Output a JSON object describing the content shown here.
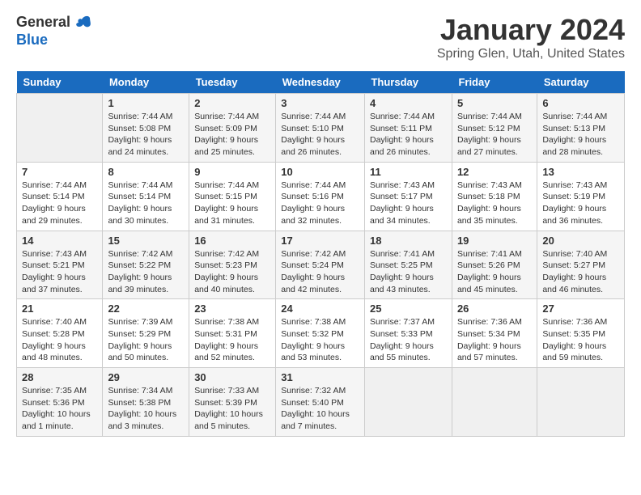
{
  "logo": {
    "general": "General",
    "blue": "Blue"
  },
  "title": "January 2024",
  "location": "Spring Glen, Utah, United States",
  "days_of_week": [
    "Sunday",
    "Monday",
    "Tuesday",
    "Wednesday",
    "Thursday",
    "Friday",
    "Saturday"
  ],
  "weeks": [
    [
      {
        "day": "",
        "info": ""
      },
      {
        "day": "1",
        "info": "Sunrise: 7:44 AM\nSunset: 5:08 PM\nDaylight: 9 hours\nand 24 minutes."
      },
      {
        "day": "2",
        "info": "Sunrise: 7:44 AM\nSunset: 5:09 PM\nDaylight: 9 hours\nand 25 minutes."
      },
      {
        "day": "3",
        "info": "Sunrise: 7:44 AM\nSunset: 5:10 PM\nDaylight: 9 hours\nand 26 minutes."
      },
      {
        "day": "4",
        "info": "Sunrise: 7:44 AM\nSunset: 5:11 PM\nDaylight: 9 hours\nand 26 minutes."
      },
      {
        "day": "5",
        "info": "Sunrise: 7:44 AM\nSunset: 5:12 PM\nDaylight: 9 hours\nand 27 minutes."
      },
      {
        "day": "6",
        "info": "Sunrise: 7:44 AM\nSunset: 5:13 PM\nDaylight: 9 hours\nand 28 minutes."
      }
    ],
    [
      {
        "day": "7",
        "info": "Sunrise: 7:44 AM\nSunset: 5:14 PM\nDaylight: 9 hours\nand 29 minutes."
      },
      {
        "day": "8",
        "info": "Sunrise: 7:44 AM\nSunset: 5:14 PM\nDaylight: 9 hours\nand 30 minutes."
      },
      {
        "day": "9",
        "info": "Sunrise: 7:44 AM\nSunset: 5:15 PM\nDaylight: 9 hours\nand 31 minutes."
      },
      {
        "day": "10",
        "info": "Sunrise: 7:44 AM\nSunset: 5:16 PM\nDaylight: 9 hours\nand 32 minutes."
      },
      {
        "day": "11",
        "info": "Sunrise: 7:43 AM\nSunset: 5:17 PM\nDaylight: 9 hours\nand 34 minutes."
      },
      {
        "day": "12",
        "info": "Sunrise: 7:43 AM\nSunset: 5:18 PM\nDaylight: 9 hours\nand 35 minutes."
      },
      {
        "day": "13",
        "info": "Sunrise: 7:43 AM\nSunset: 5:19 PM\nDaylight: 9 hours\nand 36 minutes."
      }
    ],
    [
      {
        "day": "14",
        "info": "Sunrise: 7:43 AM\nSunset: 5:21 PM\nDaylight: 9 hours\nand 37 minutes."
      },
      {
        "day": "15",
        "info": "Sunrise: 7:42 AM\nSunset: 5:22 PM\nDaylight: 9 hours\nand 39 minutes."
      },
      {
        "day": "16",
        "info": "Sunrise: 7:42 AM\nSunset: 5:23 PM\nDaylight: 9 hours\nand 40 minutes."
      },
      {
        "day": "17",
        "info": "Sunrise: 7:42 AM\nSunset: 5:24 PM\nDaylight: 9 hours\nand 42 minutes."
      },
      {
        "day": "18",
        "info": "Sunrise: 7:41 AM\nSunset: 5:25 PM\nDaylight: 9 hours\nand 43 minutes."
      },
      {
        "day": "19",
        "info": "Sunrise: 7:41 AM\nSunset: 5:26 PM\nDaylight: 9 hours\nand 45 minutes."
      },
      {
        "day": "20",
        "info": "Sunrise: 7:40 AM\nSunset: 5:27 PM\nDaylight: 9 hours\nand 46 minutes."
      }
    ],
    [
      {
        "day": "21",
        "info": "Sunrise: 7:40 AM\nSunset: 5:28 PM\nDaylight: 9 hours\nand 48 minutes."
      },
      {
        "day": "22",
        "info": "Sunrise: 7:39 AM\nSunset: 5:29 PM\nDaylight: 9 hours\nand 50 minutes."
      },
      {
        "day": "23",
        "info": "Sunrise: 7:38 AM\nSunset: 5:31 PM\nDaylight: 9 hours\nand 52 minutes."
      },
      {
        "day": "24",
        "info": "Sunrise: 7:38 AM\nSunset: 5:32 PM\nDaylight: 9 hours\nand 53 minutes."
      },
      {
        "day": "25",
        "info": "Sunrise: 7:37 AM\nSunset: 5:33 PM\nDaylight: 9 hours\nand 55 minutes."
      },
      {
        "day": "26",
        "info": "Sunrise: 7:36 AM\nSunset: 5:34 PM\nDaylight: 9 hours\nand 57 minutes."
      },
      {
        "day": "27",
        "info": "Sunrise: 7:36 AM\nSunset: 5:35 PM\nDaylight: 9 hours\nand 59 minutes."
      }
    ],
    [
      {
        "day": "28",
        "info": "Sunrise: 7:35 AM\nSunset: 5:36 PM\nDaylight: 10 hours\nand 1 minute."
      },
      {
        "day": "29",
        "info": "Sunrise: 7:34 AM\nSunset: 5:38 PM\nDaylight: 10 hours\nand 3 minutes."
      },
      {
        "day": "30",
        "info": "Sunrise: 7:33 AM\nSunset: 5:39 PM\nDaylight: 10 hours\nand 5 minutes."
      },
      {
        "day": "31",
        "info": "Sunrise: 7:32 AM\nSunset: 5:40 PM\nDaylight: 10 hours\nand 7 minutes."
      },
      {
        "day": "",
        "info": ""
      },
      {
        "day": "",
        "info": ""
      },
      {
        "day": "",
        "info": ""
      }
    ]
  ]
}
